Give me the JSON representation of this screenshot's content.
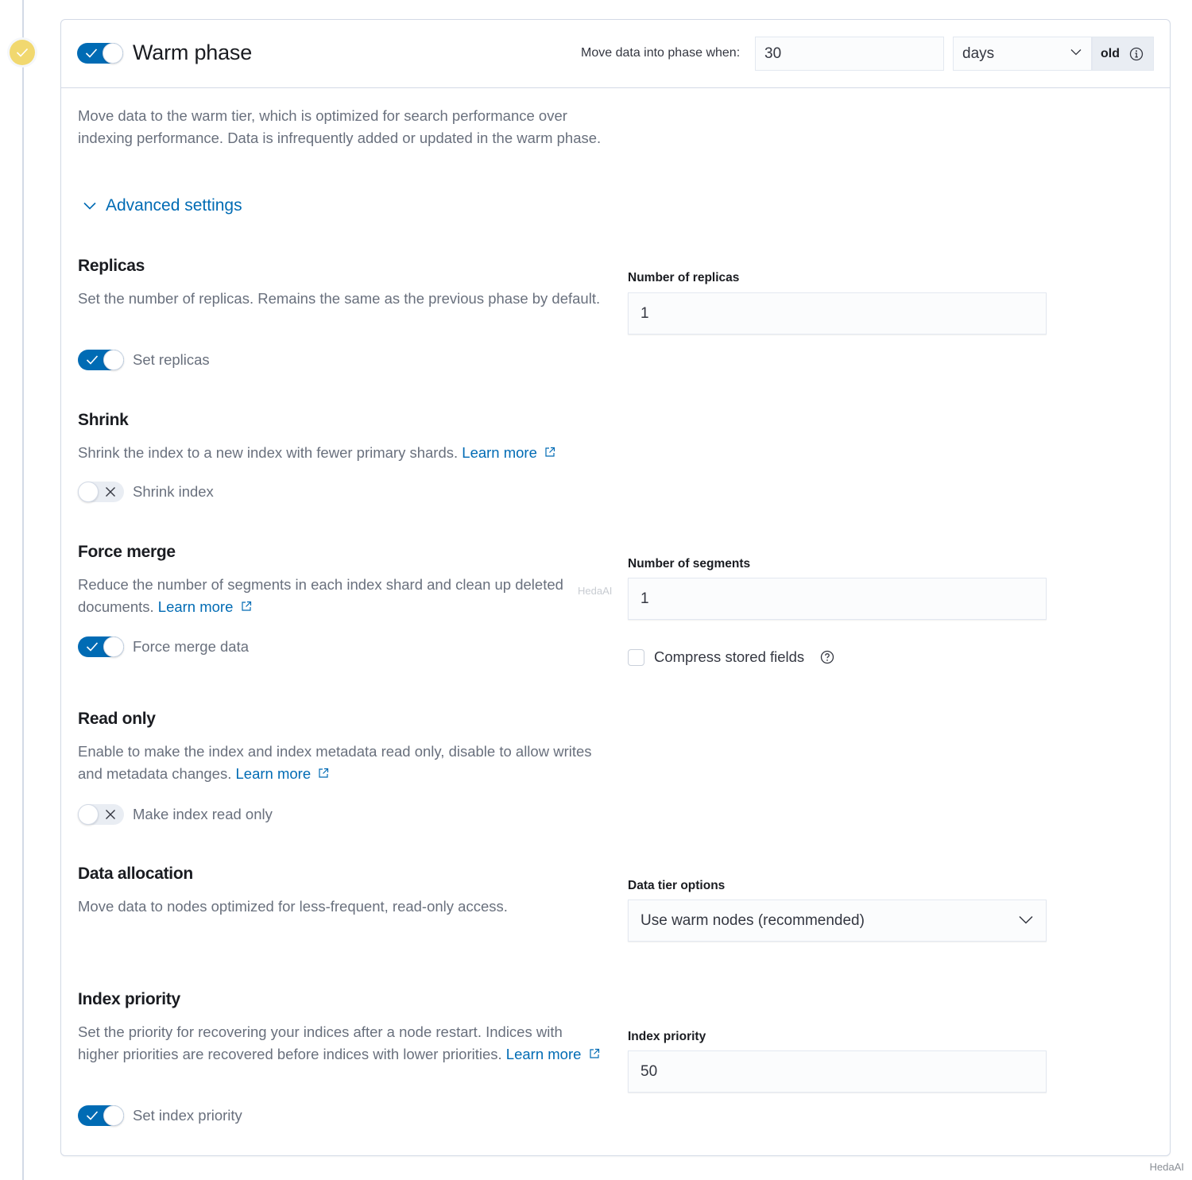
{
  "phase": {
    "title": "Warm phase",
    "enabled": true,
    "badge_color": "#f1d86f",
    "move_label": "Move data into phase when:",
    "min_age_value": "30",
    "min_age_unit": "days",
    "min_age_suffix": "old",
    "description": "Move data to the warm tier, which is optimized for search performance over indexing performance. Data is infrequently added or updated in the warm phase.",
    "advanced_settings_label": "Advanced settings"
  },
  "sections": {
    "replicas": {
      "title": "Replicas",
      "description": "Set the number of replicas. Remains the same as the previous phase by default.",
      "switch_label": "Set replicas",
      "switch_on": true,
      "field_label": "Number of replicas",
      "field_value": "1"
    },
    "shrink": {
      "title": "Shrink",
      "description": "Shrink the index to a new index with fewer primary shards.",
      "link": "Learn more",
      "switch_label": "Shrink index",
      "switch_on": false
    },
    "forcemerge": {
      "title": "Force merge",
      "description": "Reduce the number of segments in each index shard and clean up deleted documents.",
      "link": "Learn more",
      "switch_label": "Force merge data",
      "switch_on": true,
      "field_label": "Number of segments",
      "field_value": "1",
      "checkbox_label": "Compress stored fields",
      "checkbox_checked": false
    },
    "readonly": {
      "title": "Read only",
      "description": "Enable to make the index and index metadata read only, disable to allow writes and metadata changes.",
      "link": "Learn more",
      "switch_label": "Make index read only",
      "switch_on": false
    },
    "allocation": {
      "title": "Data allocation",
      "description": "Move data to nodes optimized for less-frequent, read-only access.",
      "field_label": "Data tier options",
      "field_value": "Use warm nodes (recommended)"
    },
    "priority": {
      "title": "Index priority",
      "description": "Set the priority for recovering your indices after a node restart. Indices with higher priorities are recovered before indices with lower priorities.",
      "link": "Learn more",
      "switch_label": "Set index priority",
      "switch_on": true,
      "field_label": "Index priority",
      "field_value": "50"
    }
  },
  "watermark": "HedaAI"
}
